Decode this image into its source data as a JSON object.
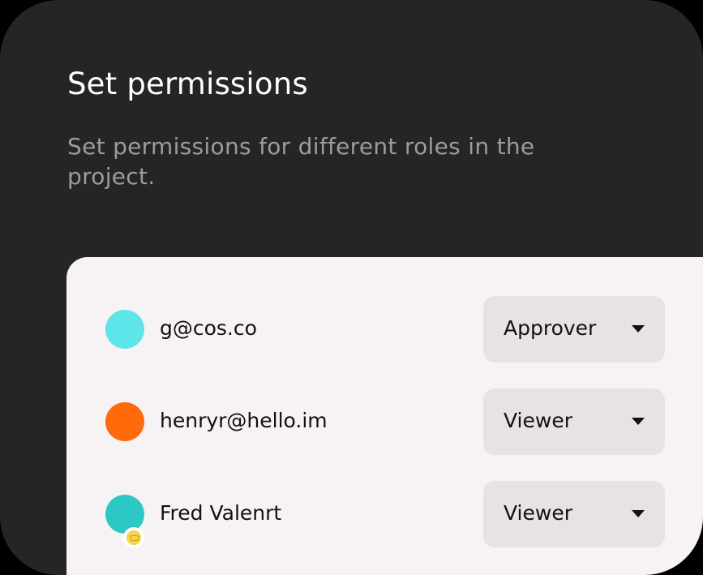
{
  "dialog": {
    "title": "Set permissions",
    "subtitle": "Set permissions for different roles in the project."
  },
  "members": [
    {
      "name": "g@cos.co",
      "role": "Approver",
      "avatar_color": "#5ee5e9",
      "has_badge": false
    },
    {
      "name": "henryr@hello.im",
      "role": "Viewer",
      "avatar_color": "#ff6a0b",
      "has_badge": false
    },
    {
      "name": "Fred Valenrt",
      "role": "Viewer",
      "avatar_color": "#2cc8c4",
      "has_badge": true
    }
  ],
  "icons": {
    "dropdown": "caret-down-icon",
    "badge": "ticket-icon"
  },
  "colors": {
    "card_background": "#252525",
    "panel_background": "#f7f2f3",
    "select_background": "#e8e2e3",
    "badge": "#f5d34b"
  }
}
